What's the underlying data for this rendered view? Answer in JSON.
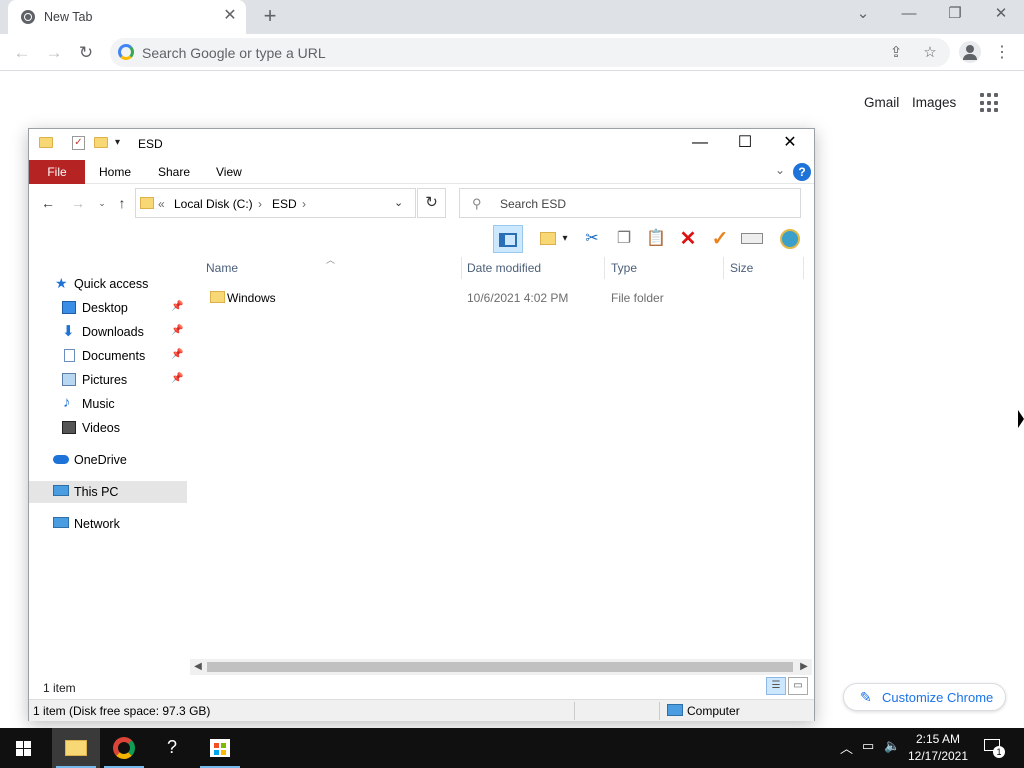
{
  "chrome": {
    "tab_title": "New Tab",
    "omnibox_placeholder": "Search Google or type a URL",
    "ntp_links": [
      "Gmail",
      "Images"
    ],
    "customize_label": "Customize Chrome"
  },
  "explorer": {
    "title": "ESD",
    "ribbon_tabs": [
      "File",
      "Home",
      "Share",
      "View"
    ],
    "breadcrumb": [
      "Local Disk (C:)",
      "ESD"
    ],
    "search_placeholder": "Search ESD",
    "nav": [
      {
        "label": "Quick access",
        "icon": "star-icon",
        "pinned": false
      },
      {
        "label": "Desktop",
        "icon": "desktop-icon",
        "pinned": true
      },
      {
        "label": "Downloads",
        "icon": "download-arrow-icon",
        "pinned": true
      },
      {
        "label": "Documents",
        "icon": "document-icon",
        "pinned": true
      },
      {
        "label": "Pictures",
        "icon": "pictures-icon",
        "pinned": true
      },
      {
        "label": "Music",
        "icon": "music-note-icon",
        "pinned": false
      },
      {
        "label": "Videos",
        "icon": "film-icon",
        "pinned": false
      },
      {
        "label": "OneDrive",
        "icon": "cloud-icon",
        "pinned": false
      },
      {
        "label": "This PC",
        "icon": "computer-icon",
        "pinned": false
      },
      {
        "label": "Network",
        "icon": "network-icon",
        "pinned": false
      }
    ],
    "columns": [
      "Name",
      "Date modified",
      "Type",
      "Size"
    ],
    "rows": [
      {
        "name": "Windows",
        "date": "10/6/2021 4:02 PM",
        "type": "File folder",
        "size": ""
      }
    ],
    "item_count": "1 item",
    "status_left": "1 item (Disk free space: 97.3 GB)",
    "status_right": "Computer",
    "selected_nav": "This PC"
  },
  "taskbar": {
    "time": "2:15 AM",
    "date": "12/17/2021",
    "notification_count": "1"
  },
  "colors": {
    "file_tab": "#b62323",
    "accent_blue": "#1a73e8",
    "folder_yellow": "#f8d775",
    "taskbar": "#101010"
  }
}
